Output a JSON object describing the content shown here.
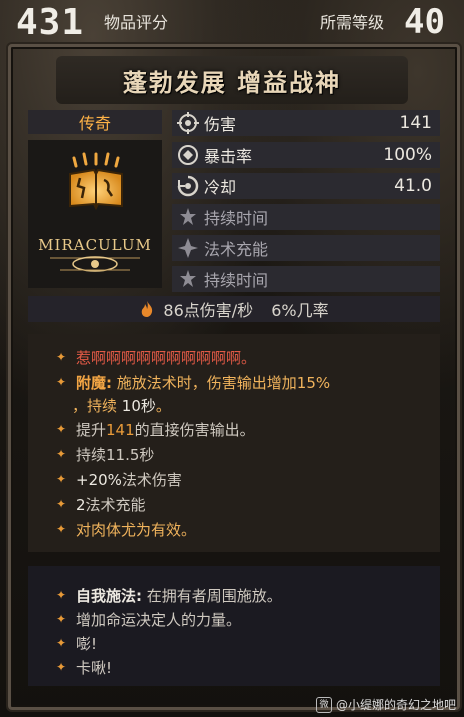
{
  "header": {
    "item_score": "431",
    "item_score_label": "物品评分",
    "required_level_label": "所需等级",
    "required_level": "40"
  },
  "item": {
    "title": "蓬勃发展 增益战神",
    "rarity": "传奇",
    "icon": "glowing-book-icon",
    "brand_logo_text": "MIRACULUM"
  },
  "stats": [
    {
      "icon": "damage-icon",
      "label": "伤害",
      "value": "141",
      "active": true
    },
    {
      "icon": "crit-icon",
      "label": "暴击率",
      "value": "100%",
      "active": true
    },
    {
      "icon": "cooldown-icon",
      "label": "冷却",
      "value": "41.0",
      "active": true
    },
    {
      "icon": "duration-icon",
      "label": "持续时间",
      "value": "",
      "active": false
    },
    {
      "icon": "spell-charge-icon",
      "label": "法术充能",
      "value": "",
      "active": false
    },
    {
      "icon": "duration-icon",
      "label": "持续时间",
      "value": "",
      "active": false
    }
  ],
  "dps": {
    "damage_per_sec": "86点伤害/秒",
    "chance": "6%几率"
  },
  "effects": [
    {
      "text": "惹啊啊啊啊啊啊啊啊啊啊。",
      "style": "red"
    },
    {
      "prefix": "附魔:",
      "text": "施放法术时，伤害输出增加15%",
      "cont_a": "，持续 ",
      "cont_b": "10秒",
      "cont_c": "。"
    },
    {
      "pre": "提升",
      "hi": "141",
      "post": "的直接伤害输出。"
    },
    {
      "text": "持续11.5秒"
    },
    {
      "hi": "+20%",
      "post": "法术伤害"
    },
    {
      "hi": "2",
      "post": "法术充能"
    },
    {
      "text": "对肉体尤为有效。"
    }
  ],
  "self_cast": [
    {
      "prefix": "自我施法:",
      "text": "在拥有者周围施放。"
    },
    {
      "text": "增加命运决定人的力量。"
    },
    {
      "text": "嘭!"
    },
    {
      "text": "卡啾!"
    }
  ],
  "watermark": {
    "platform_icon": "weibo-icon",
    "text": "@小缇娜的奇幻之地吧"
  },
  "colors": {
    "legendary": "#ffb347",
    "title": "#e8d6b8",
    "accent_orange": "#e89a38",
    "negative_red": "#e25a46"
  }
}
